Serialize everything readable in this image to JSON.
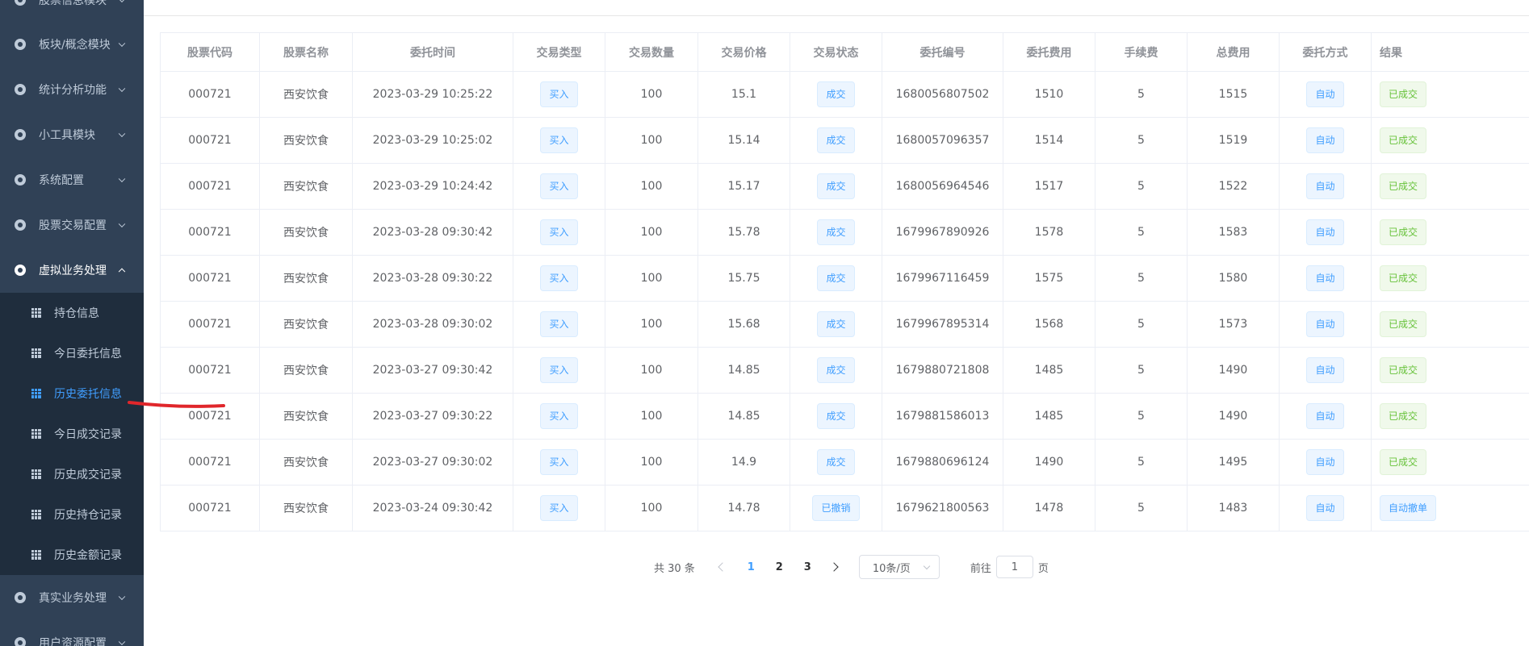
{
  "sidebar": {
    "top_item": {
      "label": "股票信息模块"
    },
    "items_before": [
      {
        "label": "板块/概念模块"
      },
      {
        "label": "统计分析功能"
      },
      {
        "label": "小工具模块"
      },
      {
        "label": "系统配置"
      },
      {
        "label": "股票交易配置"
      }
    ],
    "open_item": {
      "label": "虚拟业务处理"
    },
    "sub_items": [
      {
        "label": "持仓信息",
        "active": false
      },
      {
        "label": "今日委托信息",
        "active": false
      },
      {
        "label": "历史委托信息",
        "active": true
      },
      {
        "label": "今日成交记录",
        "active": false
      },
      {
        "label": "历史成交记录",
        "active": false
      },
      {
        "label": "历史持仓记录",
        "active": false
      },
      {
        "label": "历史金额记录",
        "active": false
      }
    ],
    "items_after": [
      {
        "label": "真实业务处理"
      },
      {
        "label": "用户资源配置"
      }
    ]
  },
  "table": {
    "headers": [
      "股票代码",
      "股票名称",
      "委托时间",
      "交易类型",
      "交易数量",
      "交易价格",
      "交易状态",
      "委托编号",
      "委托费用",
      "手续费",
      "总费用",
      "委托方式",
      "结果"
    ],
    "rows": [
      {
        "code": "000721",
        "name": "西安饮食",
        "time": "2023-03-29 10:25:22",
        "type": "买入",
        "qty": "100",
        "price": "15.1",
        "status": "成交",
        "id": "1680056807502",
        "fee": "1510",
        "commission": "5",
        "total": "1515",
        "mode": "自动",
        "result": "已成交",
        "result_kind": "success"
      },
      {
        "code": "000721",
        "name": "西安饮食",
        "time": "2023-03-29 10:25:02",
        "type": "买入",
        "qty": "100",
        "price": "15.14",
        "status": "成交",
        "id": "1680057096357",
        "fee": "1514",
        "commission": "5",
        "total": "1519",
        "mode": "自动",
        "result": "已成交",
        "result_kind": "success"
      },
      {
        "code": "000721",
        "name": "西安饮食",
        "time": "2023-03-29 10:24:42",
        "type": "买入",
        "qty": "100",
        "price": "15.17",
        "status": "成交",
        "id": "1680056964546",
        "fee": "1517",
        "commission": "5",
        "total": "1522",
        "mode": "自动",
        "result": "已成交",
        "result_kind": "success"
      },
      {
        "code": "000721",
        "name": "西安饮食",
        "time": "2023-03-28 09:30:42",
        "type": "买入",
        "qty": "100",
        "price": "15.78",
        "status": "成交",
        "id": "1679967890926",
        "fee": "1578",
        "commission": "5",
        "total": "1583",
        "mode": "自动",
        "result": "已成交",
        "result_kind": "success"
      },
      {
        "code": "000721",
        "name": "西安饮食",
        "time": "2023-03-28 09:30:22",
        "type": "买入",
        "qty": "100",
        "price": "15.75",
        "status": "成交",
        "id": "1679967116459",
        "fee": "1575",
        "commission": "5",
        "total": "1580",
        "mode": "自动",
        "result": "已成交",
        "result_kind": "success"
      },
      {
        "code": "000721",
        "name": "西安饮食",
        "time": "2023-03-28 09:30:02",
        "type": "买入",
        "qty": "100",
        "price": "15.68",
        "status": "成交",
        "id": "1679967895314",
        "fee": "1568",
        "commission": "5",
        "total": "1573",
        "mode": "自动",
        "result": "已成交",
        "result_kind": "success"
      },
      {
        "code": "000721",
        "name": "西安饮食",
        "time": "2023-03-27 09:30:42",
        "type": "买入",
        "qty": "100",
        "price": "14.85",
        "status": "成交",
        "id": "1679880721808",
        "fee": "1485",
        "commission": "5",
        "total": "1490",
        "mode": "自动",
        "result": "已成交",
        "result_kind": "success"
      },
      {
        "code": "000721",
        "name": "西安饮食",
        "time": "2023-03-27 09:30:22",
        "type": "买入",
        "qty": "100",
        "price": "14.85",
        "status": "成交",
        "id": "1679881586013",
        "fee": "1485",
        "commission": "5",
        "total": "1490",
        "mode": "自动",
        "result": "已成交",
        "result_kind": "success"
      },
      {
        "code": "000721",
        "name": "西安饮食",
        "time": "2023-03-27 09:30:02",
        "type": "买入",
        "qty": "100",
        "price": "14.9",
        "status": "成交",
        "id": "1679880696124",
        "fee": "1490",
        "commission": "5",
        "total": "1495",
        "mode": "自动",
        "result": "已成交",
        "result_kind": "success"
      },
      {
        "code": "000721",
        "name": "西安饮食",
        "time": "2023-03-24 09:30:42",
        "type": "买入",
        "qty": "100",
        "price": "14.78",
        "status": "已撤销",
        "id": "1679621800563",
        "fee": "1478",
        "commission": "5",
        "total": "1483",
        "mode": "自动",
        "result": "自动撤单",
        "result_kind": "primary"
      }
    ]
  },
  "pagination": {
    "total": "共 30 条",
    "pages": [
      "1",
      "2",
      "3"
    ],
    "current": "1",
    "page_size": "10条/页",
    "goto_prefix": "前往",
    "goto_value": "1",
    "goto_suffix": "页"
  },
  "colors": {
    "sidebar_bg": "#304156",
    "submenu_bg": "#1f2d3d",
    "accent": "#409eff",
    "success": "#67c23a",
    "annotation": "#e0262b"
  },
  "icons": {
    "menu": "menu-circle-icon",
    "submenu": "table-grid-icon"
  }
}
